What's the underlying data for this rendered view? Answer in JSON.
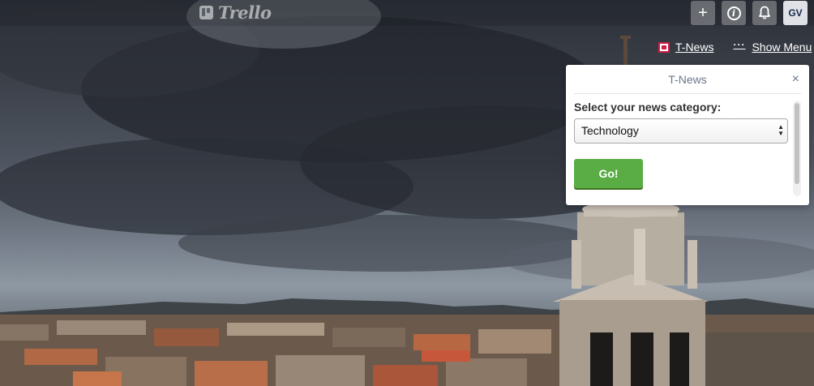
{
  "header": {
    "logo_text": "Trello",
    "add_button": "+",
    "info_button": "i",
    "avatar_initials": "GV"
  },
  "board_links": {
    "tnews_label": "T-News",
    "menu_dots": "···",
    "show_menu_label": "Show Menu"
  },
  "popover": {
    "title": "T-News",
    "close": "×",
    "category_label": "Select your news category:",
    "selected_category": "Technology",
    "go_label": "Go!"
  },
  "colors": {
    "go_button": "#5aac44",
    "tnews_icon": "#d21e44",
    "avatar_bg": "#dfe1e6"
  }
}
